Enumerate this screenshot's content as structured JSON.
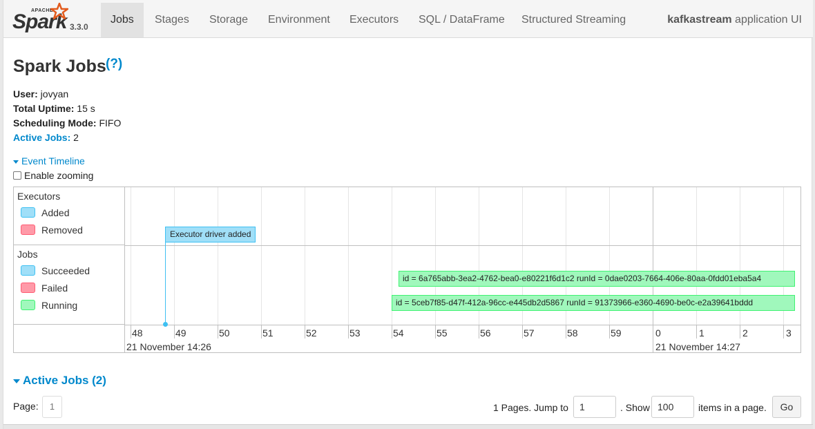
{
  "navbar": {
    "brand_apache": "APACHE",
    "brand_name": "Spark",
    "version": "3.3.0",
    "tabs": [
      {
        "label": "Jobs",
        "active": true
      },
      {
        "label": "Stages"
      },
      {
        "label": "Storage"
      },
      {
        "label": "Environment"
      },
      {
        "label": "Executors"
      },
      {
        "label": "SQL / DataFrame"
      },
      {
        "label": "Structured Streaming"
      }
    ],
    "app_name": "kafkastream",
    "app_suffix": " application UI"
  },
  "page": {
    "title": "Spark Jobs",
    "help": "(?)"
  },
  "summary": {
    "user_label": "User:",
    "user_value": " jovyan",
    "uptime_label": "Total Uptime:",
    "uptime_value": " 15 s",
    "sched_label": "Scheduling Mode:",
    "sched_value": " FIFO",
    "active_label": "Active Jobs:",
    "active_value": " 2"
  },
  "timeline": {
    "toggle_label": "Event Timeline",
    "zoom_label": "Enable zooming",
    "executors_label": "Executors",
    "executors_legend": [
      "Added",
      "Removed"
    ],
    "jobs_label": "Jobs",
    "jobs_legend": [
      "Succeeded",
      "Failed",
      "Running"
    ],
    "executor_event": "Executor driver added",
    "jobs": [
      "id = 6a765abb-3ea2-4762-bea0-e80221f6d1c2 runId = 0dae0203-7664-406e-80aa-0fdd01eba5a4",
      "id = 5ceb7f85-d47f-412a-96cc-e445db2d5867 runId = 91373966-e360-4690-be0c-e2a39641bddd"
    ],
    "ticks": [
      "48",
      "49",
      "50",
      "51",
      "52",
      "53",
      "54",
      "55",
      "56",
      "57",
      "58",
      "59",
      "0",
      "1",
      "2",
      "3"
    ],
    "date_1": "21 November 14:26",
    "date_2": "21 November 14:27",
    "colors": {
      "added": "#a0dff8",
      "removed": "#ff9aa8",
      "running": "#a0f8bc"
    }
  },
  "active_jobs": {
    "heading": "Active Jobs (2)",
    "page_label": "Page:",
    "page_current": "1",
    "pages_text": "1 Pages. Jump to",
    "jump_value": "1",
    "show_text": ". Show",
    "show_value": "100",
    "items_text": "items in a page.",
    "go_label": "Go"
  }
}
